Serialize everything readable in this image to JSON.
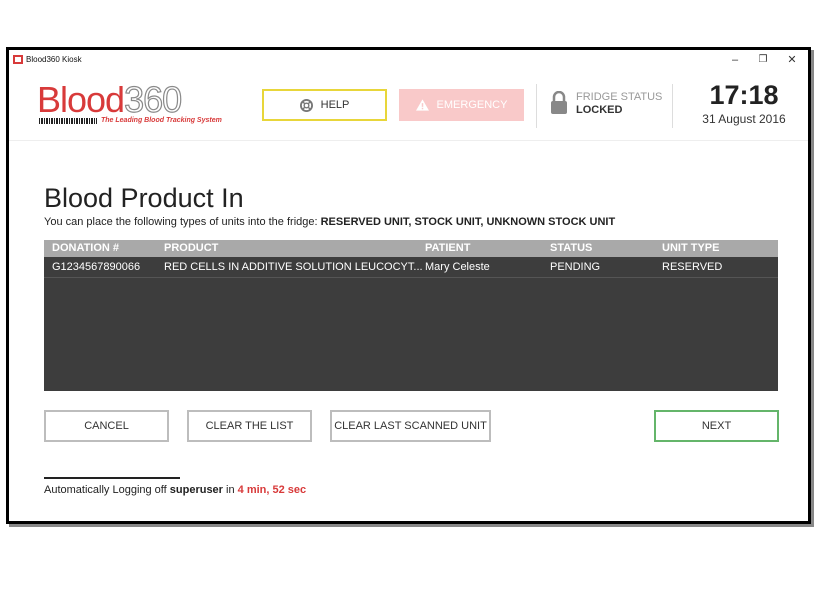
{
  "window": {
    "title": "Blood360 Kiosk",
    "minimize": "–",
    "maximize": "❐",
    "close": "✕"
  },
  "header": {
    "logo_blood": "Blood",
    "logo_360": "360",
    "tagline": "The Leading Blood Tracking System",
    "help_label": "HELP",
    "emergency_label": "EMERGENCY",
    "fridge_status_label": "FRIDGE STATUS",
    "fridge_status_value": "LOCKED",
    "time": "17:18",
    "date": "31 August 2016"
  },
  "main": {
    "title": "Blood Product In",
    "subtitle_prefix": "You can place the following types of units into the fridge: ",
    "subtitle_types": "RESERVED UNIT, STOCK UNIT, UNKNOWN STOCK UNIT"
  },
  "table": {
    "columns": [
      "DONATION #",
      "PRODUCT",
      "PATIENT",
      "STATUS",
      "UNIT TYPE"
    ],
    "rows": [
      [
        "G1234567890066",
        "RED CELLS IN ADDITIVE SOLUTION LEUCOCYT...",
        "Mary Celeste",
        "PENDING",
        "RESERVED"
      ]
    ]
  },
  "actions": {
    "cancel": "CANCEL",
    "clear_list": "CLEAR THE LIST",
    "clear_last": "CLEAR LAST SCANNED UNIT",
    "next": "NEXT"
  },
  "footer": {
    "logoff_prefix": "Automatically Logging off ",
    "user": "superuser",
    "in_text": " in ",
    "time_left": "4 min, 52 sec"
  },
  "colors": {
    "brand_red": "#d83a3a",
    "help_border": "#e8d63a",
    "emergency_bg": "#f9c9c9",
    "next_border": "#64b56a",
    "table_bg": "#3d3d3d"
  },
  "icons": {
    "app": "blood360-app-icon",
    "help": "lifebuoy-icon",
    "emergency": "warning-triangle-icon",
    "fridge": "lock-icon"
  }
}
